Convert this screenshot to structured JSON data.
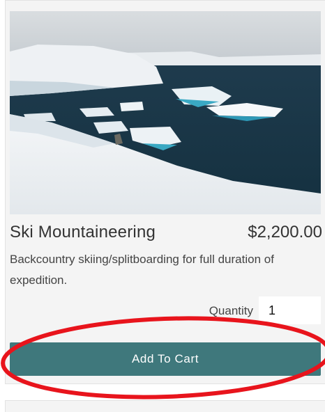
{
  "product": {
    "title": "Ski Mountaineering",
    "price": "$2,200.00",
    "description": "Backcountry skiing/splitboarding for full duration of expedition.",
    "quantity_label": "Quantity",
    "quantity_value": "1",
    "add_to_cart_label": "Add To Cart"
  },
  "colors": {
    "button": "#3f787c",
    "highlight": "#e8141c",
    "card_background": "#f4f4f4"
  }
}
